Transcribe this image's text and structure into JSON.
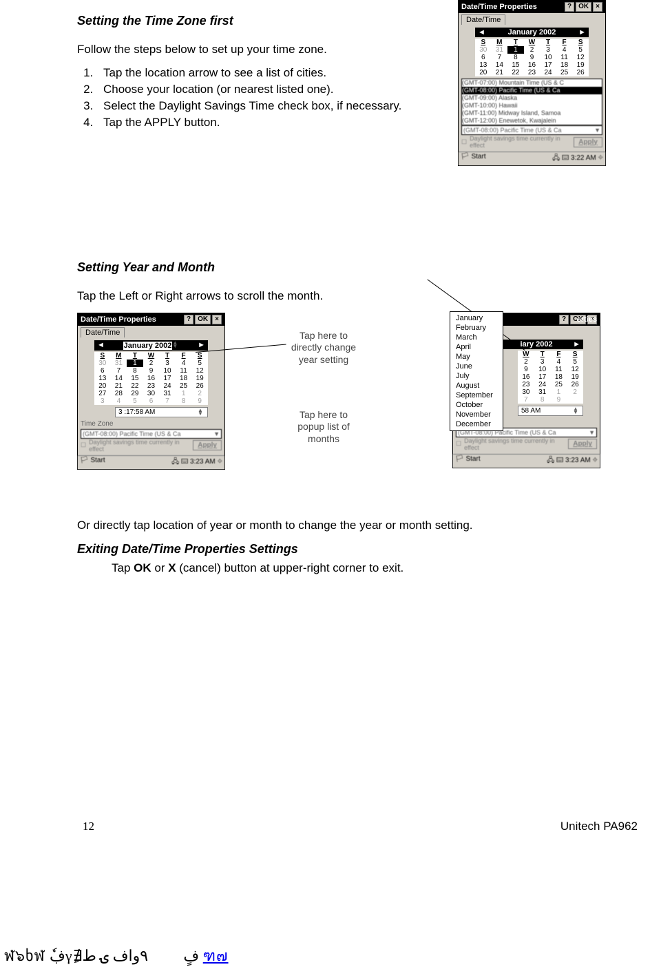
{
  "section1": {
    "heading": "Setting the Time Zone first",
    "intro": "Follow the steps below to set up your time zone.",
    "steps": [
      "Tap the location arrow to see a list of cities.",
      "Choose your location (or nearest listed one).",
      "Select the Daylight Savings Time check box, if  necessary.",
      "Tap the APPLY button."
    ]
  },
  "section2": {
    "heading": "Setting Year and Month",
    "intro": "Tap the Left or Right arrows to scroll the month.",
    "outro": "Or directly tap location of year or month to change the year or month setting."
  },
  "section3": {
    "heading": "Exiting Date/Time Properties Settings",
    "text_pre": "Tap ",
    "ok": "OK",
    "or": " or ",
    "x": "X",
    "text_post": " (cancel) button at upper-right corner to exit."
  },
  "callouts": {
    "year": "Tap here to directly change year setting",
    "month": "Tap here to popup list of months"
  },
  "pda_common": {
    "title": "Date/Time Properties",
    "help": "?",
    "ok": "OK",
    "close": "×",
    "tab": "Date/Time",
    "prev": "◄",
    "next": "►",
    "dow": [
      "S",
      "M",
      "T",
      "W",
      "T",
      "F",
      "S"
    ],
    "apply": "Apply",
    "dst": "Daylight savings time currently in effect",
    "tz_label": "Time Zone",
    "start": "Start"
  },
  "pda_top": {
    "month": "January 2002",
    "weeks": [
      [
        "30",
        "31",
        "1",
        "2",
        "3",
        "4",
        "5"
      ],
      [
        "6",
        "7",
        "8",
        "9",
        "10",
        "11",
        "12"
      ],
      [
        "13",
        "14",
        "15",
        "16",
        "17",
        "18",
        "19"
      ],
      [
        "20",
        "21",
        "22",
        "23",
        "24",
        "25",
        "26"
      ]
    ],
    "selected_day": "1",
    "tz_items": [
      "(GMT-07:00) Mountain Time (US & C",
      "(GMT-08:00) Pacific Time (US & Ca",
      "(GMT-09:00) Alaska",
      "(GMT-10:00) Hawaii",
      "(GMT-11:00) Midway Island, Samoa",
      "(GMT-12:00) Enewetok, Kwajalein"
    ],
    "tz_sel": "(GMT-08:00) Pacific Time (US & Ca",
    "clock": "3:22 AM"
  },
  "pda_left": {
    "month": "January  2002",
    "weeks": [
      [
        "30",
        "31",
        "1",
        "2",
        "3",
        "4",
        "5"
      ],
      [
        "6",
        "7",
        "8",
        "9",
        "10",
        "11",
        "12"
      ],
      [
        "13",
        "14",
        "15",
        "16",
        "17",
        "18",
        "19"
      ],
      [
        "20",
        "21",
        "22",
        "23",
        "24",
        "25",
        "26"
      ],
      [
        "27",
        "28",
        "29",
        "30",
        "31",
        "1",
        "2"
      ],
      [
        "3",
        "4",
        "5",
        "6",
        "7",
        "8",
        "9"
      ]
    ],
    "selected_day": "1",
    "time": "3 :17:58 AM",
    "tz": "(GMT-08:00) Pacific Time (US & Ca",
    "clock": "3:23 AM"
  },
  "pda_right": {
    "month": "iary 2002",
    "weeks_partial": [
      [
        "W",
        "T",
        "F",
        "S"
      ],
      [
        "2",
        "3",
        "4",
        "5"
      ],
      [
        "9",
        "10",
        "11",
        "12"
      ],
      [
        "16",
        "17",
        "18",
        "19"
      ],
      [
        "23",
        "24",
        "25",
        "26"
      ],
      [
        "30",
        "31",
        "1",
        "2"
      ],
      [
        "7",
        "8",
        "9"
      ]
    ],
    "months": [
      "January",
      "February",
      "March",
      "April",
      "May",
      "June",
      "July",
      "August",
      "September",
      "October",
      "November",
      "December"
    ],
    "time": "58 AM",
    "tz": "(GMT-08:00) Pacific Time (US & Ca",
    "clock": "3:23 AM"
  },
  "footer": {
    "page": "12",
    "product": "Unitech PA962"
  },
  "garbled_footer": "ฬ๖ხฬ    ڣٗγ∄ِفٍ٩۶ٰٟواف    ۍ    ط    "
}
